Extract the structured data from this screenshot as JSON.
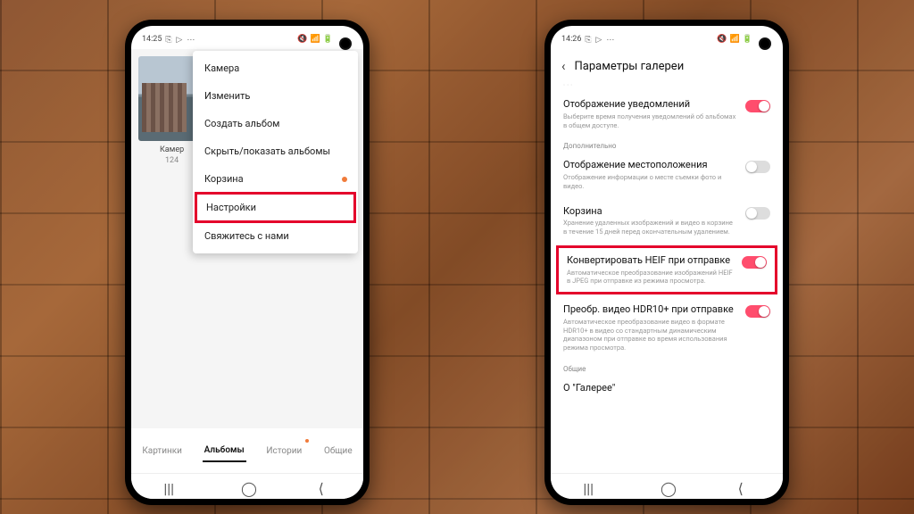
{
  "phone1": {
    "time": "14:25",
    "status_icons": [
      "⎘",
      "▷",
      "⋯"
    ],
    "status_right": [
      "🔇",
      "📶",
      "📶",
      "🔋"
    ],
    "thumb_label": "Камер",
    "thumb_count": "124",
    "menu": {
      "items": [
        {
          "label": "Камера",
          "badge": false
        },
        {
          "label": "Изменить",
          "badge": false
        },
        {
          "label": "Создать альбом",
          "badge": false
        },
        {
          "label": "Скрыть/показать альбомы",
          "badge": false
        },
        {
          "label": "Корзина",
          "badge": true
        },
        {
          "label": "Настройки",
          "badge": false,
          "highlight": true
        },
        {
          "label": "Свяжитесь с нами",
          "badge": false
        }
      ]
    },
    "tabs": [
      {
        "label": "Картинки",
        "active": false
      },
      {
        "label": "Альбомы",
        "active": true
      },
      {
        "label": "Истории",
        "active": false,
        "dot": true
      },
      {
        "label": "Общие",
        "active": false
      }
    ]
  },
  "phone2": {
    "time": "14:26",
    "header": "Параметры галереи",
    "faint_top": "",
    "sections": [
      {
        "items": [
          {
            "title": "Отображение уведомлений",
            "desc": "Выберите время получения уведомлений об альбомах в общем доступе.",
            "toggle": "on"
          }
        ]
      },
      {
        "label": "Дополнительно",
        "items": [
          {
            "title": "Отображение местоположения",
            "desc": "Отображение информации о месте съемки фото и видео.",
            "toggle": "off"
          },
          {
            "title": "Корзина",
            "desc": "Хранение удаленных изображений и видео в корзине в течение 15 дней перед окончательным удалением.",
            "toggle": "off"
          },
          {
            "title": "Конвертировать HEIF при отправке",
            "desc": "Автоматическое преобразование изображений HEIF в JPEG при отправке из режима просмотра.",
            "toggle": "on",
            "highlight": true
          },
          {
            "title": "Преобр. видео HDR10+ при отправке",
            "desc": "Автоматическое преобразование видео в формате HDR10+ в видео со стандартным динамическим диапазоном при отправке во время использования режима просмотра.",
            "toggle": "on"
          }
        ]
      },
      {
        "label": "Общие",
        "items": [
          {
            "title": "О \"Галерее\"",
            "desc": "",
            "toggle": null
          }
        ]
      }
    ]
  }
}
